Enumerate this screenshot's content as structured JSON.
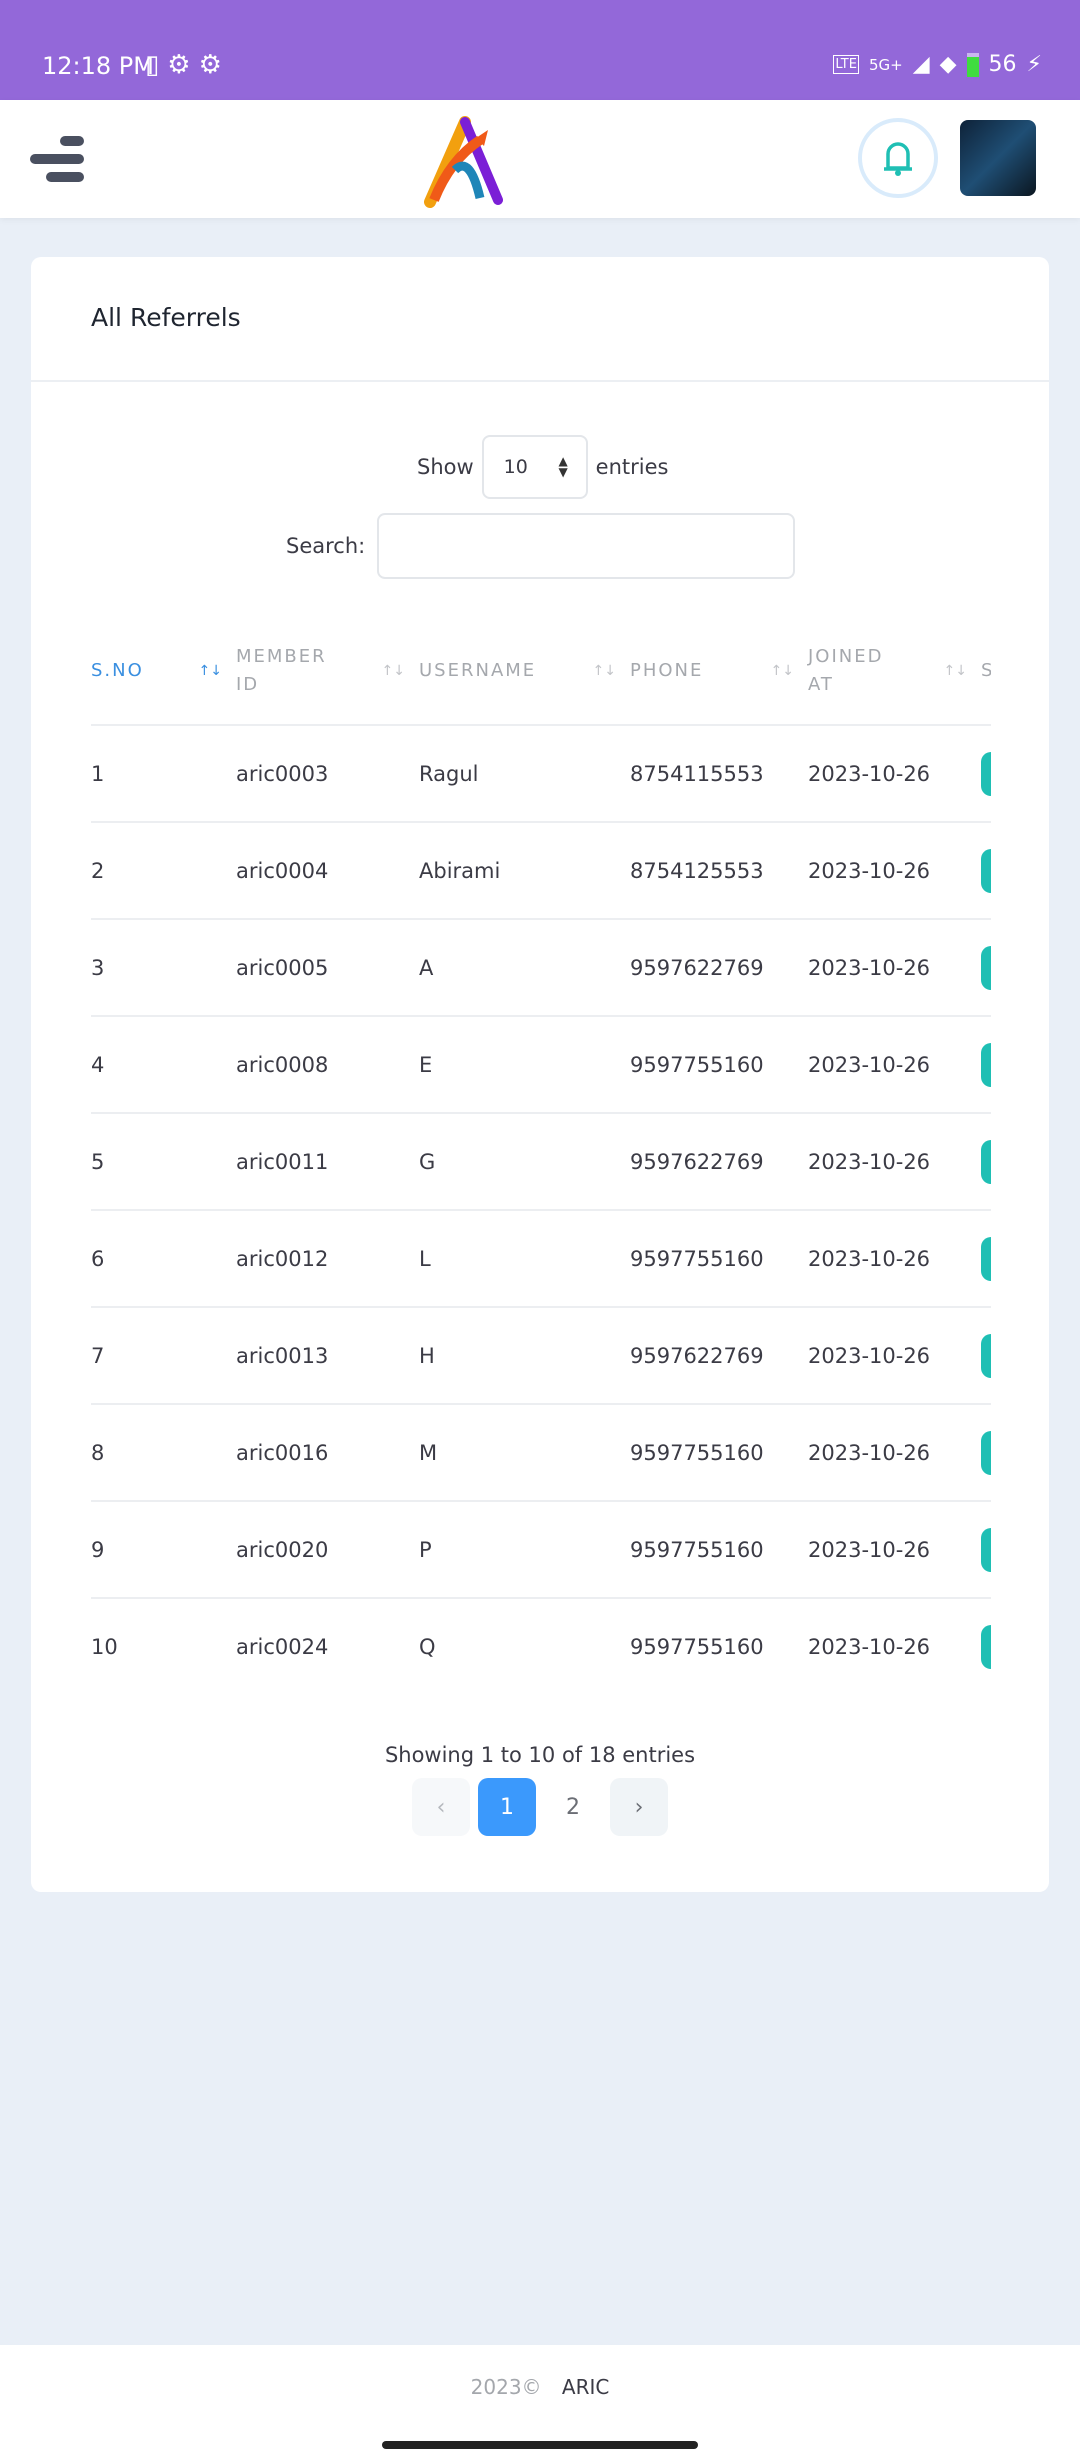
{
  "status_bar": {
    "time": "12:18 PM",
    "signal": "5G+",
    "battery": "56"
  },
  "header": {
    "menu_icon": "hamburger-icon",
    "logo": "A",
    "notification_icon": "bell-icon"
  },
  "card": {
    "title": "All Referrels"
  },
  "length": {
    "show_label": "Show",
    "value": "10",
    "entries_label": "entries"
  },
  "search": {
    "label": "Search:",
    "value": "",
    "placeholder": ""
  },
  "table": {
    "columns": [
      {
        "l1": "S.NO",
        "l2": ""
      },
      {
        "l1": "MEMBER",
        "l2": "ID"
      },
      {
        "l1": "USERNAME",
        "l2": ""
      },
      {
        "l1": "PHONE",
        "l2": ""
      },
      {
        "l1": "JOINED",
        "l2": "AT"
      },
      {
        "l1": "S",
        "l2": ""
      }
    ],
    "rows": [
      [
        "1",
        "aric0003",
        "Ragul",
        "8754115553",
        "2023-10-26"
      ],
      [
        "2",
        "aric0004",
        "Abirami",
        "8754125553",
        "2023-10-26"
      ],
      [
        "3",
        "aric0005",
        "A",
        "9597622769",
        "2023-10-26"
      ],
      [
        "4",
        "aric0008",
        "E",
        "9597755160",
        "2023-10-26"
      ],
      [
        "5",
        "aric0011",
        "G",
        "9597622769",
        "2023-10-26"
      ],
      [
        "6",
        "aric0012",
        "L",
        "9597755160",
        "2023-10-26"
      ],
      [
        "7",
        "aric0013",
        "H",
        "9597622769",
        "2023-10-26"
      ],
      [
        "8",
        "aric0016",
        "M",
        "9597755160",
        "2023-10-26"
      ],
      [
        "9",
        "aric0020",
        "P",
        "9597755160",
        "2023-10-26"
      ],
      [
        "10",
        "aric0024",
        "Q",
        "9597755160",
        "2023-10-26"
      ]
    ]
  },
  "pagination": {
    "info": "Showing 1 to 10 of 18 entries",
    "prev": "‹",
    "pages": [
      "1",
      "2"
    ],
    "current": "1",
    "next": "›"
  },
  "footer": {
    "year": "2023©",
    "brand": "ARIC"
  },
  "colors": {
    "status_bar": "#9368d9",
    "accent": "#3b99fc",
    "badge": "#1fbfb4"
  }
}
